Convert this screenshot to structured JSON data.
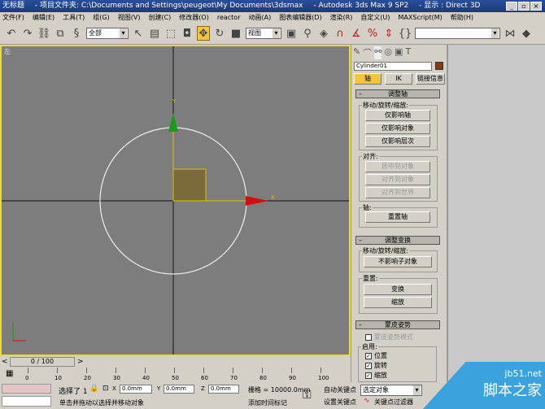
{
  "title": {
    "doc": "无标题",
    "project": "- 项目文件夹: C:\\Documents and Settings\\peugeot\\My Documents\\3dsmax",
    "app": "- Autodesk 3ds Max 9 SP2",
    "display": "- 显示 : Direct 3D"
  },
  "menu": [
    "文件(F)",
    "编辑(E)",
    "工具(T)",
    "组(G)",
    "视图(V)",
    "创建(C)",
    "修改器(O)",
    "reactor",
    "动画(A)",
    "图表编辑器(D)",
    "渲染(R)",
    "自定义(U)",
    "MAXScript(M)",
    "帮助(H)"
  ],
  "toolbar": {
    "selection_filter": "全部",
    "ref_coord": "视图",
    "named_sel": ""
  },
  "viewport": {
    "label": "左",
    "axis_y": "Y",
    "axis_x": "X"
  },
  "cmd": {
    "object_name": "Cylinder01",
    "object_color": "#8a3a10",
    "tabs": [
      "轴",
      "IK",
      "链接信息"
    ],
    "adjust_pivot": {
      "title": "调整轴",
      "move_group": "移动/旋转/缩放:",
      "b1": "仅影响轴",
      "b2": "仅影响对象",
      "b3": "仅影响层次",
      "align_group": "对齐:",
      "a1": "居中到对象",
      "a2": "对齐到对象",
      "a3": "对齐到世界",
      "pivot_group": "轴:",
      "reset": "重置轴"
    },
    "adjust_transform": {
      "title": "调整变换",
      "move_group": "移动/旋转/缩放:",
      "b1": "不影响子对象",
      "reset_group": "重置:",
      "r1": "变换",
      "r2": "缩放"
    },
    "skin_pose": {
      "title": "蒙皮姿势",
      "mode": "蒙皮姿势模式",
      "enable_group": "启用:",
      "c1": "位置",
      "c2": "旋转",
      "c3": "缩放"
    }
  },
  "timeline": {
    "frame": "0 / 100",
    "ticks": [
      "0",
      "10",
      "20",
      "30",
      "40",
      "50",
      "60",
      "70",
      "80",
      "90",
      "100"
    ]
  },
  "status": {
    "selected": "选择了 1",
    "x_label": "X",
    "x": "0.0mm",
    "y_label": "Y",
    "y": "0.0mm",
    "z_label": "Z",
    "z": "0.0mm",
    "grid": "栅格 = 10000.0mm",
    "prompt": "单击并拖动以选择并移动对象",
    "add_tag": "添加时间标记",
    "auto_key": "自动关键点",
    "set_key": "设置关键点",
    "key_mode": "选定对象",
    "key_filters": "关键点过滤器"
  },
  "watermark": {
    "site": "jb51.net",
    "name": "脚本之家"
  }
}
